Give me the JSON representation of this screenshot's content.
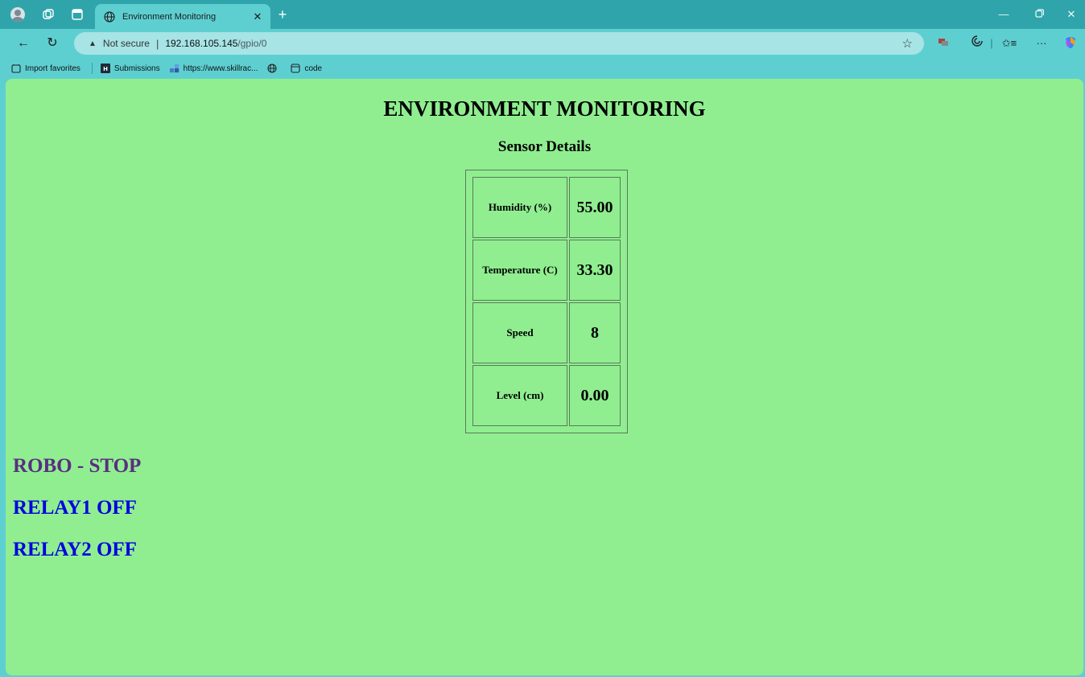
{
  "browser": {
    "tab_title": "Environment Monitoring",
    "address": {
      "security_label": "Not secure",
      "separator": "|",
      "host": "192.168.105.145",
      "path": "/gpio/0"
    },
    "favorites": [
      {
        "label": "Import favorites",
        "icon": "import-favorites-icon"
      },
      {
        "label": "Submissions",
        "icon": "submissions-icon"
      },
      {
        "label": "https://www.skillrac...",
        "icon": "skillrack-icon"
      },
      {
        "label": "",
        "icon": "globe-icon"
      },
      {
        "label": "code",
        "icon": "code-icon"
      }
    ]
  },
  "page": {
    "title": "ENVIRONMENT MONITORING",
    "subtitle": "Sensor Details",
    "sensors": [
      {
        "label": "Humidity (%)",
        "value": "55.00"
      },
      {
        "label": "Temperature (C)",
        "value": "33.30"
      },
      {
        "label": "Speed",
        "value": "8"
      },
      {
        "label": "Level (cm)",
        "value": "0.00"
      }
    ],
    "status": {
      "robo": "ROBO - STOP",
      "relay1": "RELAY1 OFF",
      "relay2": "RELAY2 OFF"
    },
    "colors": {
      "background": "#90ee90",
      "robo_status": "#5a2d82",
      "relay_status": "#0000e0"
    }
  }
}
